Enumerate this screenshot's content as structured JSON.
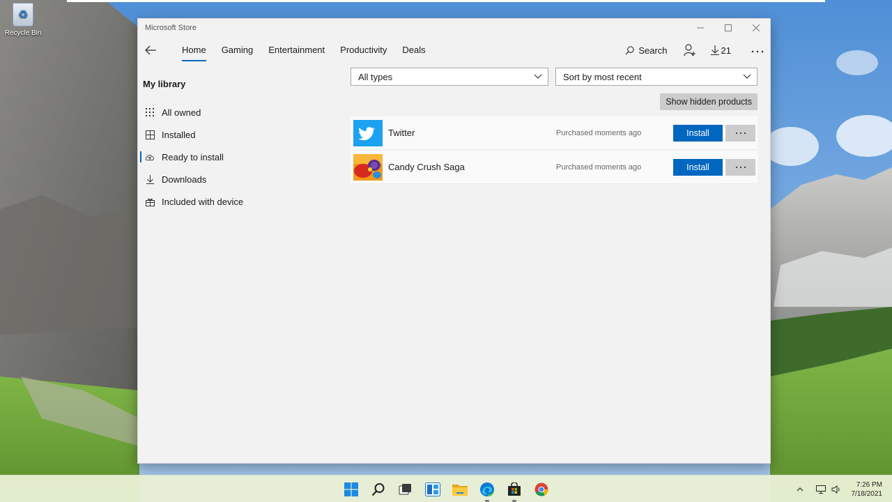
{
  "desktop": {
    "recycle_bin_label": "Recycle Bin"
  },
  "window": {
    "title": "Microsoft Store",
    "nav": {
      "tabs": [
        {
          "label": "Home",
          "active": true
        },
        {
          "label": "Gaming"
        },
        {
          "label": "Entertainment"
        },
        {
          "label": "Productivity"
        },
        {
          "label": "Deals"
        }
      ],
      "search_label": "Search",
      "downloads_count": "21"
    },
    "sidebar": {
      "title": "My library",
      "items": [
        {
          "label": "All owned",
          "icon": "grid-icon"
        },
        {
          "label": "Installed",
          "icon": "installed-icon"
        },
        {
          "label": "Ready to install",
          "icon": "cloud-icon",
          "active": true
        },
        {
          "label": "Downloads",
          "icon": "download-icon"
        },
        {
          "label": "Included with device",
          "icon": "gift-icon"
        }
      ]
    },
    "filters": {
      "type_value": "All types",
      "sort_value": "Sort by most recent"
    },
    "show_hidden_label": "Show hidden products",
    "apps": [
      {
        "name": "Twitter",
        "status": "Purchased moments ago",
        "action": "Install",
        "icon": "twitter-icon",
        "color": "#1da1f2"
      },
      {
        "name": "Candy Crush Saga",
        "status": "Purchased moments ago",
        "action": "Install",
        "icon": "candy-crush-icon",
        "color": "#e8551a"
      }
    ],
    "accent_color": "#0067c0"
  },
  "taskbar": {
    "icons": [
      "windows-start-icon",
      "search-icon",
      "task-view-icon",
      "widgets-icon",
      "file-explorer-icon",
      "edge-icon",
      "store-icon",
      "chrome-icon"
    ],
    "time": "7:26 PM",
    "date": "7/18/2021"
  }
}
